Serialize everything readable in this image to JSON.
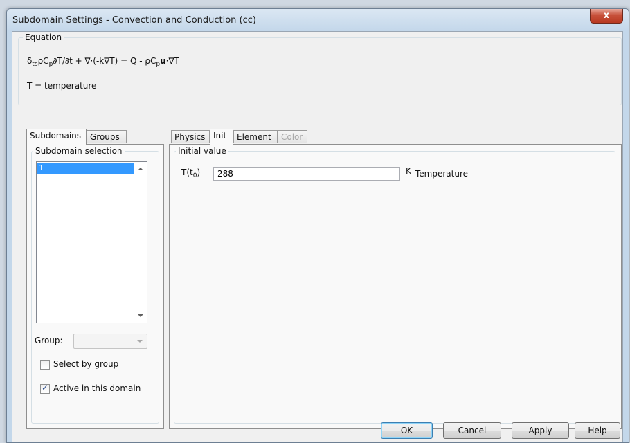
{
  "window": {
    "title": "Subdomain Settings - Convection and Conduction (cc)",
    "close_glyph": "x"
  },
  "equation": {
    "group_label": "Equation",
    "formula": {
      "p1": "δ",
      "s1": "ts",
      "p2": "ρC",
      "s2": "p",
      "p3": "∂T/∂t + ∇·(-k∇T) = Q - ρC",
      "s3": "p",
      "p4_bold": "u",
      "p5": "·∇T"
    },
    "definition": "T = temperature"
  },
  "left_tabs": [
    {
      "label": "Subdomains",
      "active": true
    },
    {
      "label": "Groups",
      "active": false
    }
  ],
  "subdomain_selection": {
    "group_label": "Subdomain selection",
    "items": [
      "1"
    ],
    "selected": "1"
  },
  "group": {
    "label": "Group:",
    "value": ""
  },
  "checkboxes": {
    "select_by_group": {
      "label": "Select by group",
      "checked": false
    },
    "active_in_domain": {
      "label": "Active in this domain",
      "checked": true
    }
  },
  "right_tabs": [
    {
      "label": "Physics",
      "active": false,
      "disabled": false
    },
    {
      "label": "Init",
      "active": true,
      "disabled": false
    },
    {
      "label": "Element",
      "active": false,
      "disabled": false
    },
    {
      "label": "Color",
      "active": false,
      "disabled": true
    }
  ],
  "initial_value": {
    "group_label": "Initial value",
    "var_main": "T(t",
    "var_sub": "0",
    "var_end": ")",
    "value": "288",
    "unit": "K",
    "description": "Temperature"
  },
  "buttons": {
    "ok": "OK",
    "cancel": "Cancel",
    "apply": "Apply",
    "help": "Help"
  },
  "icons": {
    "close": "close-icon",
    "scroll_up": "scroll-up-arrow-icon",
    "scroll_down": "scroll-down-arrow-icon",
    "dropdown": "chevron-down-icon",
    "checkmark": "checkmark-icon"
  },
  "colors": {
    "selection": "#3399ff",
    "close_button": "#c7503a",
    "frame": "#c3d7ea"
  }
}
